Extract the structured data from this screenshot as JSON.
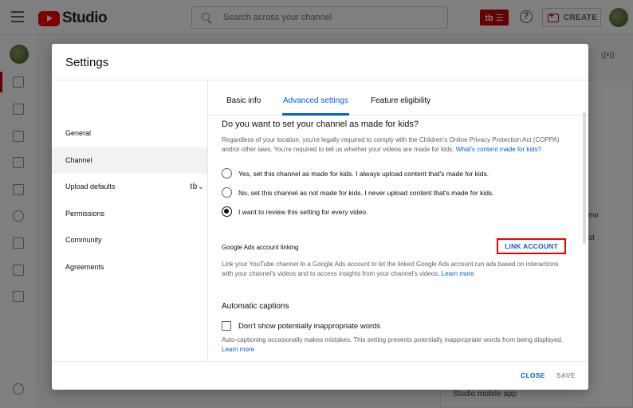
{
  "app": {
    "title": "Studio",
    "search_placeholder": "Search across your channel",
    "badge_label": "tb ☰",
    "help_label": "?",
    "create_label": "CREATE"
  },
  "background": {
    "mobile_app_text": "Studio mobile app",
    "fragment_ew": "ew",
    "fragment_st": "st",
    "live_icon_label": "((•))"
  },
  "modal": {
    "title": "Settings",
    "sidebar": {
      "items": [
        {
          "label": "General"
        },
        {
          "label": "Channel"
        },
        {
          "label": "Upload defaults",
          "extra": "tb⌄"
        },
        {
          "label": "Permissions"
        },
        {
          "label": "Community"
        },
        {
          "label": "Agreements"
        }
      ],
      "active_index": 1
    },
    "tabs": [
      {
        "label": "Basic info"
      },
      {
        "label": "Advanced settings"
      },
      {
        "label": "Feature eligibility"
      }
    ],
    "active_tab": 1,
    "kids": {
      "heading": "Do you want to set your channel as made for kids?",
      "description": "Regardless of your location, you're legally required to comply with the Children's Online Privacy Protection Act (COPPA) and/or other laws. You're required to tell us whether your videos are made for kids.",
      "description_link": "What's content made for kids?",
      "options": [
        {
          "label": "Yes, set this channel as made for kids. I always upload content that's made for kids.",
          "selected": false
        },
        {
          "label": "No, set this channel as not made for kids. I never upload content that's made for kids.",
          "selected": false
        },
        {
          "label": "I want to review this setting for every video.",
          "selected": true
        }
      ]
    },
    "ads": {
      "title": "Google Ads account linking",
      "button_label": "LINK ACCOUNT",
      "description": "Link your YouTube channel to a Google Ads account to let the linked Google Ads account run ads based on interactions with your channel's videos and to access insights from your channel's videos.",
      "learn_more": "Learn more"
    },
    "captions": {
      "heading": "Automatic captions",
      "checkbox_label": "Don't show potentially inappropriate words",
      "checked": false,
      "description": "Auto-captioning occasionally makes mistakes. This setting prevents potentially inappropriate words from being displayed.",
      "learn_more": "Learn more"
    },
    "footer": {
      "close_label": "CLOSE",
      "save_label": "SAVE"
    }
  }
}
